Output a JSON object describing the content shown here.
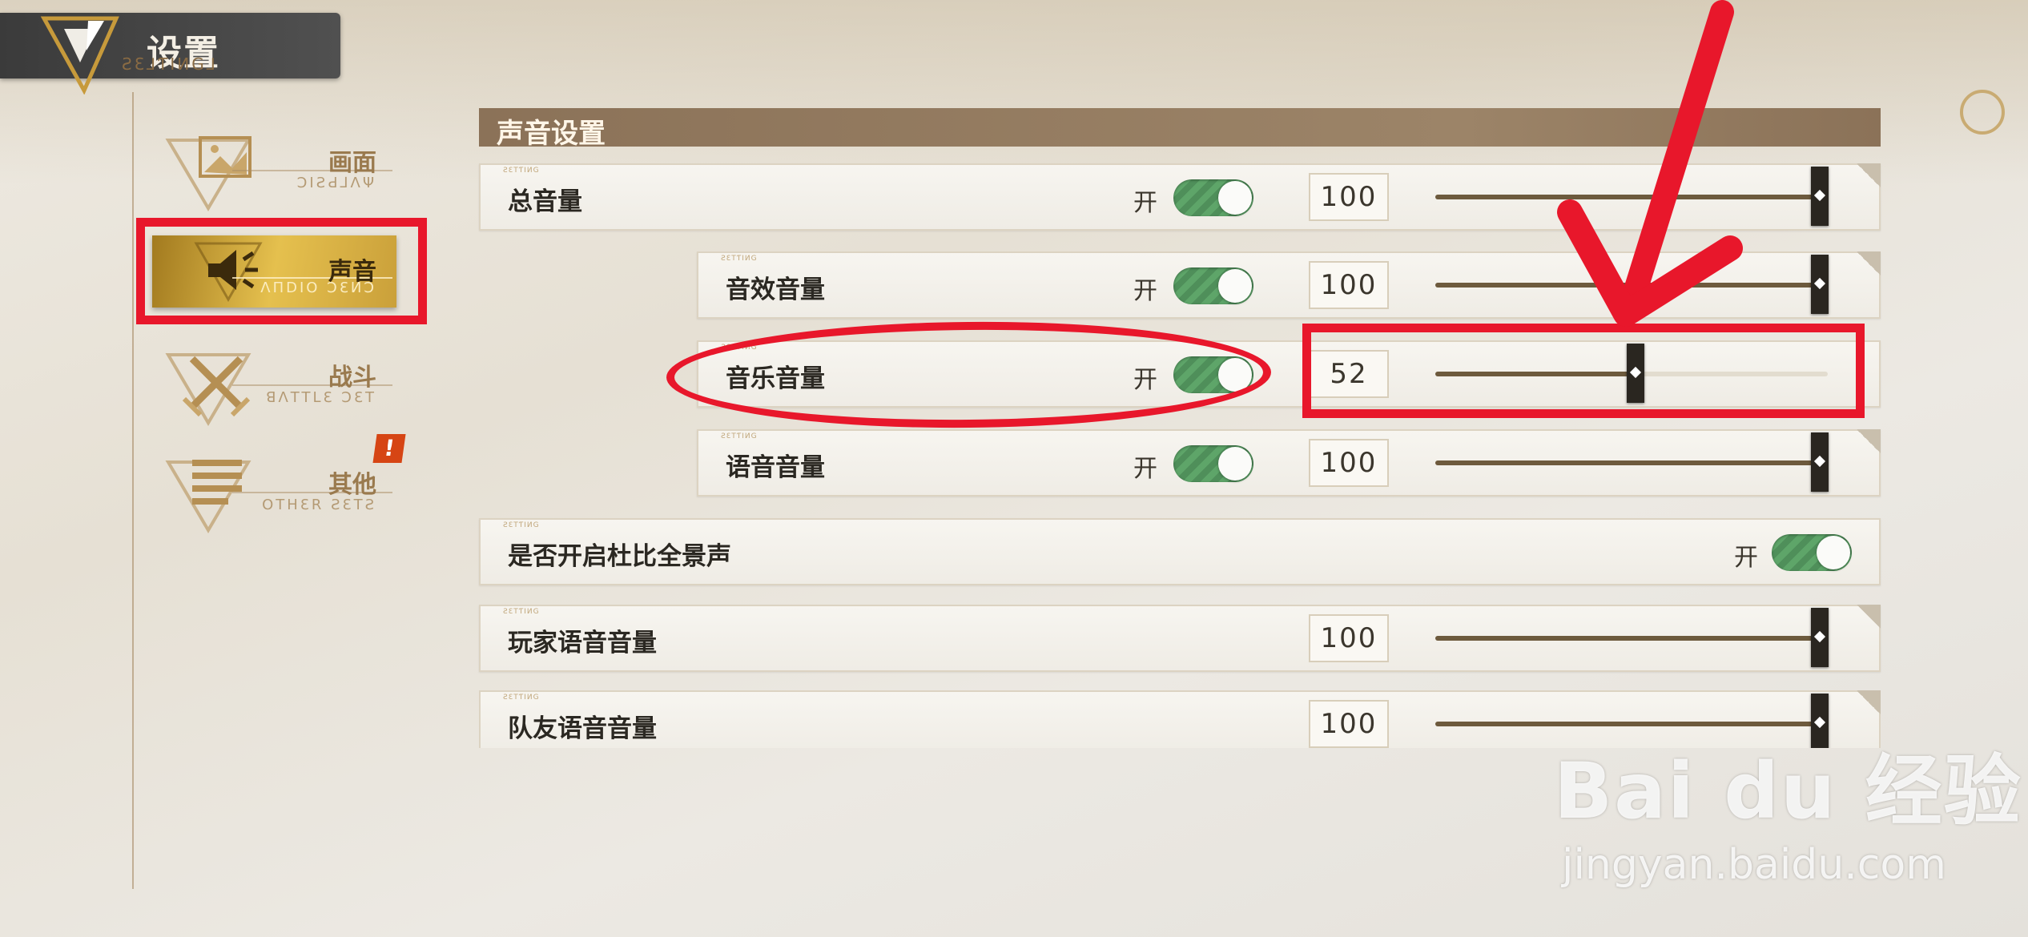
{
  "header": {
    "title": "设置",
    "subtitle": "ƧƐ⅃ƬIИG⅃"
  },
  "sidebar": {
    "items": [
      {
        "label": "画面",
        "sub": "ƆIƧԀ⅃ΛΨ",
        "active": false
      },
      {
        "label": "声音",
        "sub": "ΛПDIO ƆƐИƆ",
        "active": true
      },
      {
        "label": "战斗",
        "sub": "ꓭΛTTLƐ ƆƐT",
        "active": false
      },
      {
        "label": "其他",
        "sub": "OTHƐR ƧƐTƧ",
        "active": false
      }
    ],
    "badge": "!"
  },
  "section": {
    "title": "声音设置"
  },
  "row_tag": "ƧƐTƬIИG",
  "on_text": "开",
  "rows": [
    {
      "label": "总音量",
      "toggle": true,
      "value": "100",
      "slider": 1.0
    },
    {
      "label": "音效音量",
      "toggle": true,
      "value": "100",
      "slider": 1.0
    },
    {
      "label": "音乐音量",
      "toggle": true,
      "value": "52",
      "slider": 0.52
    },
    {
      "label": "语音音量",
      "toggle": true,
      "value": "100",
      "slider": 1.0
    },
    {
      "label": "是否开启杜比全景声",
      "toggle": true
    },
    {
      "label": "玩家语音音量",
      "value": "100",
      "slider": 1.0
    },
    {
      "label": "队友语音音量",
      "value": "100",
      "slider": 1.0
    }
  ],
  "watermark": {
    "brand": "Bai du 经验",
    "url": "jingyan.baidu.com"
  },
  "colors": {
    "accent_gold": "#e5c04e",
    "annotation_red": "#e8172b",
    "toggle_green": "#5ea569",
    "slider_fill": "#6d5a3d"
  }
}
